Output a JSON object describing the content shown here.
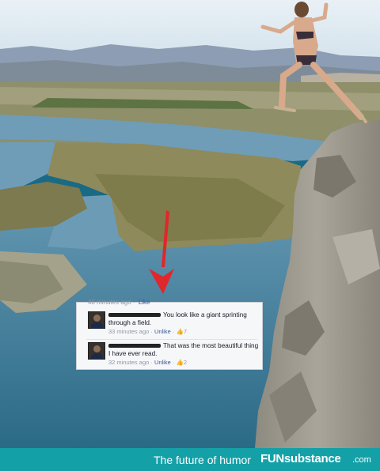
{
  "comments_box": {
    "partial_time": "40 minutes ago",
    "partial_link": "Like",
    "items": [
      {
        "text": "You look like a giant sprinting through a field.",
        "time": "33 minutes ago",
        "unlike": "Unlike",
        "likes": "7"
      },
      {
        "text": "That was the most beautiful thing I have ever read.",
        "time": "32 minutes ago",
        "unlike": "Unlike",
        "likes": "2"
      }
    ]
  },
  "footer": {
    "tagline": "The future of humor",
    "brand": "FUNsubstance",
    "domain": ".com"
  }
}
